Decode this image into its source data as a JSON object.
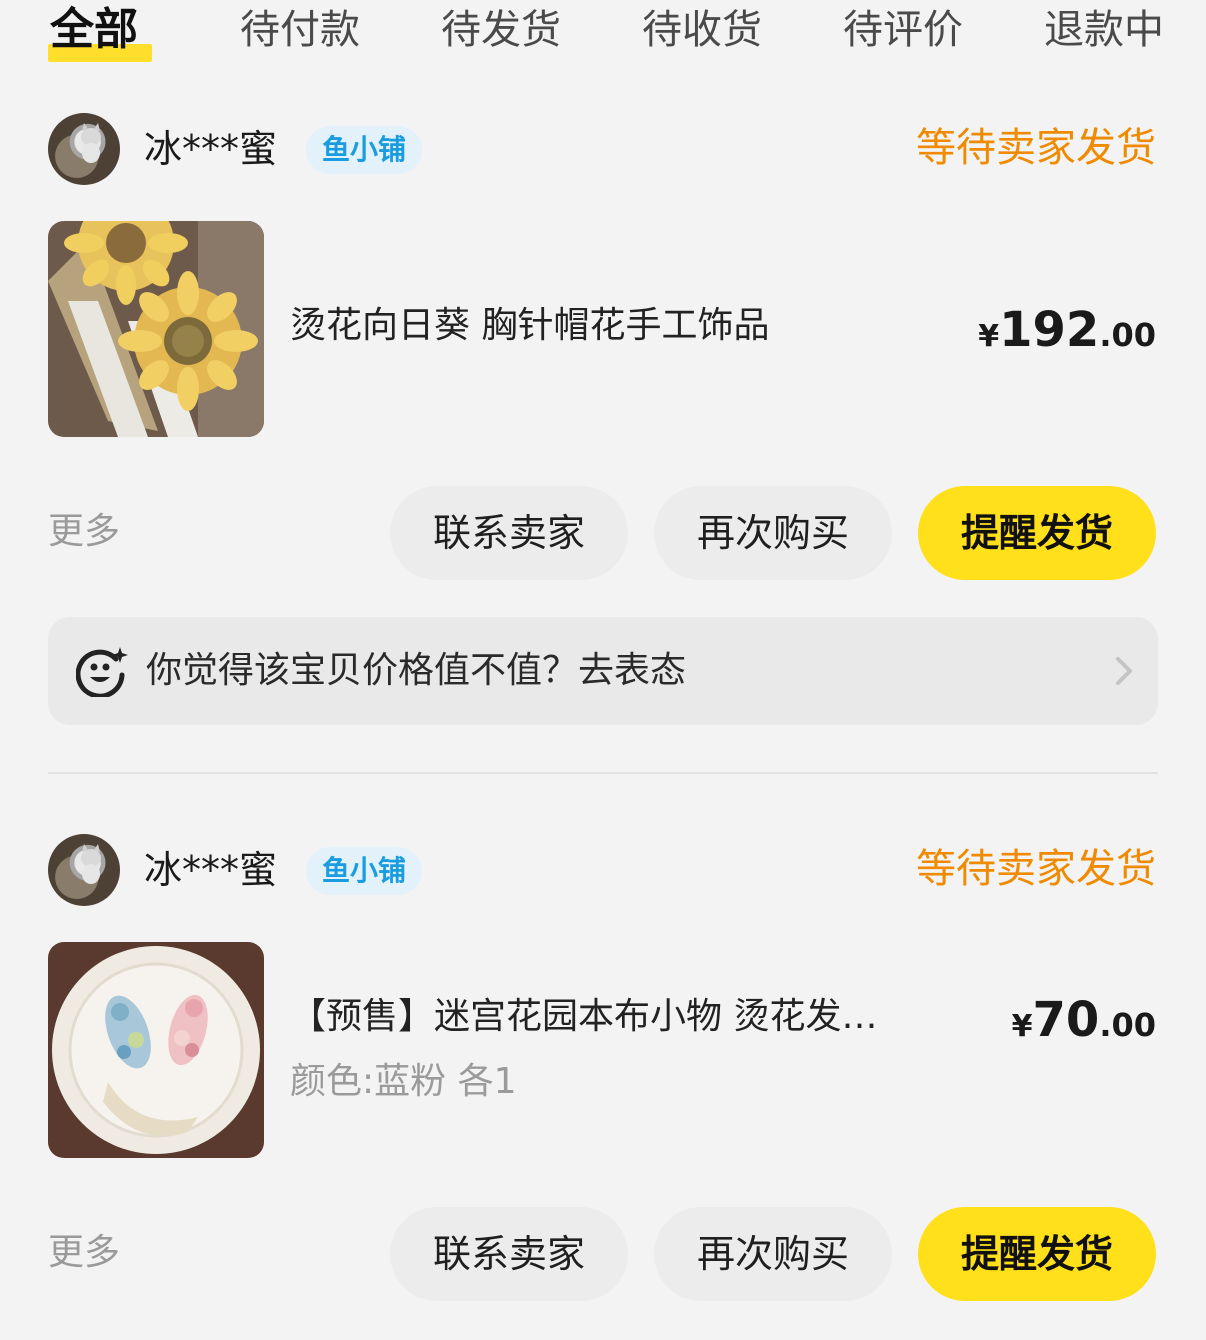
{
  "tabs": [
    {
      "label": "全部",
      "active": true
    },
    {
      "label": "待付款",
      "active": false
    },
    {
      "label": "待发货",
      "active": false
    },
    {
      "label": "待收货",
      "active": false
    },
    {
      "label": "待评价",
      "active": false
    },
    {
      "label": "退款中",
      "active": false
    }
  ],
  "orders": [
    {
      "shop_name": "冰***蜜",
      "shop_badge": "鱼小铺",
      "status": "等待卖家发货",
      "item_title": "烫花向日葵 胸针帽花手工饰品",
      "item_sku": "",
      "price_currency": "¥",
      "price_int": "192",
      "price_dec": ".00",
      "more_label": "更多",
      "buttons": {
        "contact": "联系卖家",
        "rebuy": "再次购买",
        "remind": "提醒发货"
      },
      "feedback_text": "你觉得该宝贝价格值不值？去表态"
    },
    {
      "shop_name": "冰***蜜",
      "shop_badge": "鱼小铺",
      "status": "等待卖家发货",
      "item_title": "【预售】迷宫花园本布小物 烫花发…",
      "item_sku": "颜色:蓝粉 各1",
      "price_currency": "¥",
      "price_int": "70",
      "price_dec": ".00",
      "more_label": "更多",
      "buttons": {
        "contact": "联系卖家",
        "rebuy": "再次购买",
        "remind": "提醒发货"
      }
    }
  ],
  "colors": {
    "accent_yellow": "#ffe01b",
    "status_orange": "#f08a00",
    "badge_blue": "#1a9de0",
    "background": "#f3f3f3"
  },
  "icons": {
    "feedback": "smile-sparkle-icon",
    "chevron": "chevron-right-icon"
  }
}
